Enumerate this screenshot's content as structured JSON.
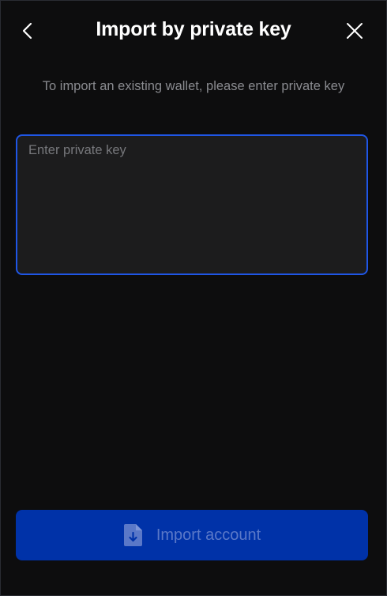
{
  "header": {
    "title": "Import by private key",
    "back_icon": "chevron-left-icon",
    "close_icon": "close-icon"
  },
  "main": {
    "subtitle": "To import an existing wallet, please enter private key",
    "private_key_input": {
      "value": "",
      "placeholder": "Enter private key"
    }
  },
  "footer": {
    "import_button_label": "Import account",
    "import_button_icon": "file-download-icon",
    "import_button_enabled": false
  },
  "colors": {
    "background": "#0d0d0e",
    "input_border": "#1f56e6",
    "button_bg": "#0032a8",
    "button_text": "#5a78c8",
    "subtitle_text": "#8a8b90"
  }
}
